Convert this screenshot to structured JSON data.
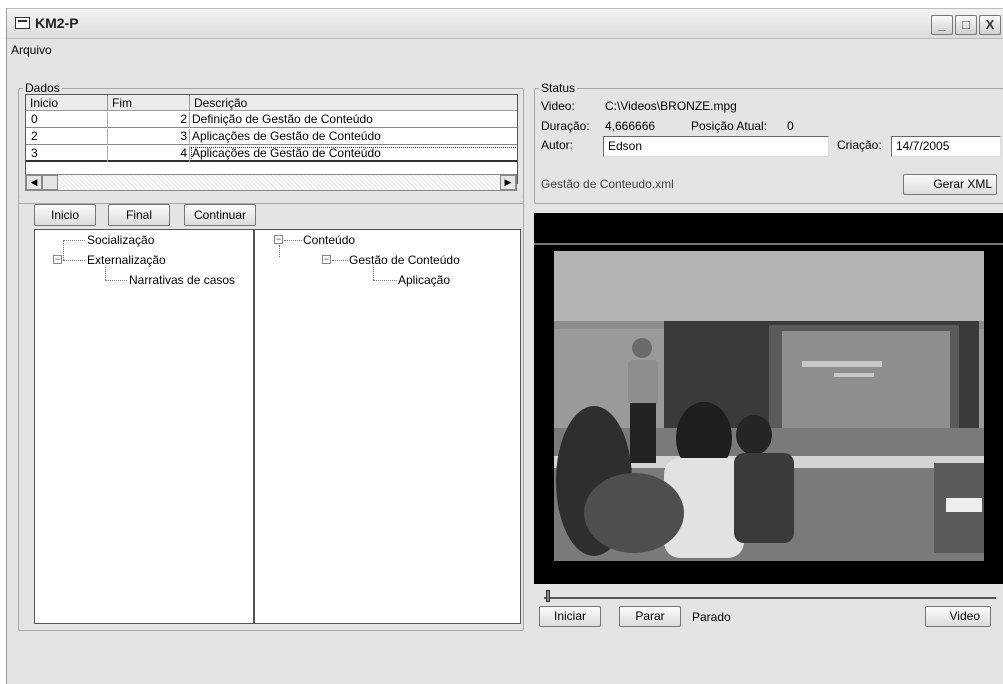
{
  "window": {
    "title": "KM2-P",
    "minimize": "_",
    "maximize": "□",
    "close": "X"
  },
  "menu": {
    "file": "Arquivo"
  },
  "dados": {
    "legend": "Dados",
    "columns": [
      "Inicio",
      "Fim",
      "Descrição"
    ],
    "rows": [
      {
        "inicio": "0",
        "fim": "2",
        "descricao": "Definição de Gestão de Conteúdo"
      },
      {
        "inicio": "2",
        "fim": "3",
        "descricao": "Aplicações de Gestão de Conteúdo"
      },
      {
        "inicio": "3",
        "fim": "4",
        "descricao": "Aplicações de Gestão de Conteúdo"
      }
    ],
    "buttons": {
      "inicio": "Inicio",
      "final": "Final",
      "continuar": "Continuar"
    }
  },
  "tree_left": {
    "root1": "Socialização",
    "root2": "Externalização",
    "child": "Narrativas de casos"
  },
  "tree_right": {
    "root": "Conteúdo",
    "child": "Gestão de Conteúdo",
    "leaf": "Aplicação"
  },
  "status": {
    "legend": "Status",
    "video_label": "Video:",
    "video_value": "C:\\Videos\\BRONZE.mpg",
    "duration_label": "Duração:",
    "duration_value": "4,666666",
    "position_label": "Posição Atual:",
    "position_value": "0",
    "author_label": "Autor:",
    "author_value": "Edson",
    "creation_label": "Criação:",
    "creation_value": "14/7/2005",
    "xml_file": "Gestão de Conteudo.xml",
    "gerar_xml": "Gerar XML"
  },
  "player": {
    "iniciar": "Iniciar",
    "parar": "Parar",
    "state": "Parado",
    "video_button": "Video",
    "progress": 0
  },
  "icons": {
    "expander": "minus-box-icon",
    "window": "window-icon"
  }
}
